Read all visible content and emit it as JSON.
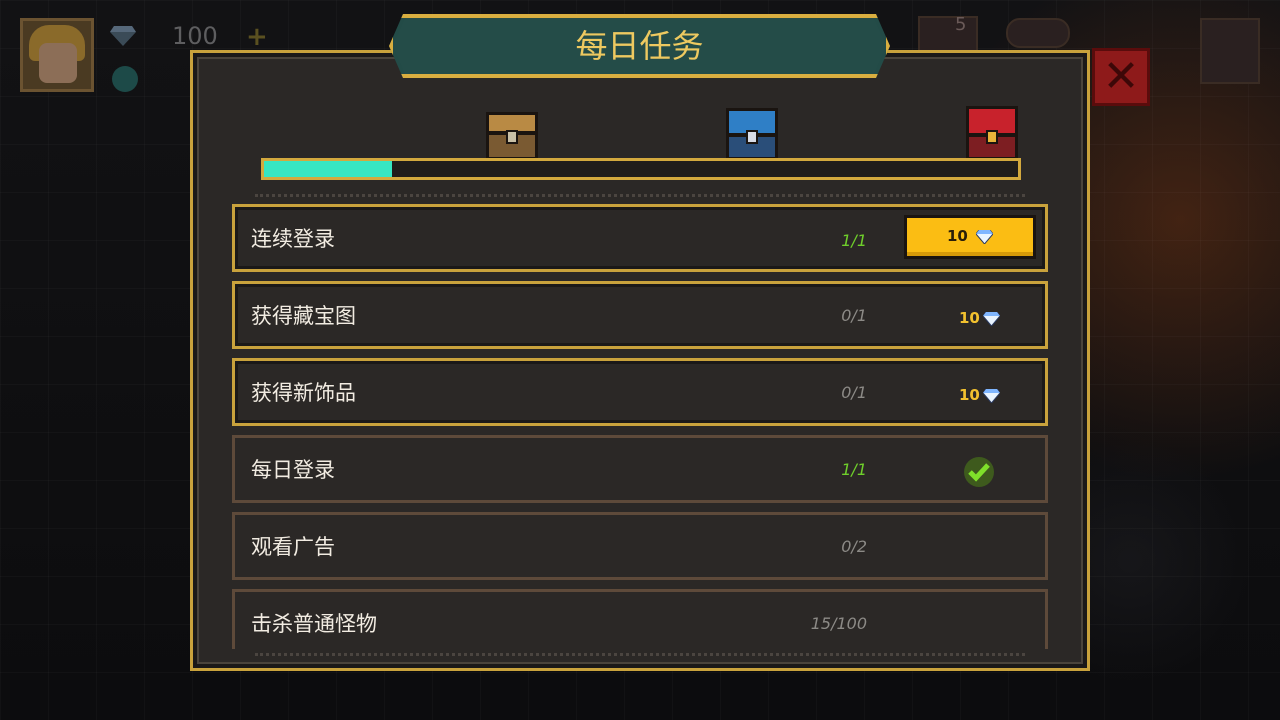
{
  "hud": {
    "gems": "100",
    "cart_badge": "5",
    "colors": {
      "gem": "#3b4b57",
      "accent": "#c9a23c"
    }
  },
  "dialog": {
    "title": "每日任务",
    "close_icon": "close-icon",
    "progress": 0.17,
    "chests": [
      {
        "icon": "wooden-chest-icon"
      },
      {
        "icon": "blue-chest-icon"
      },
      {
        "icon": "red-chest-icon"
      }
    ],
    "tasks": [
      {
        "label": "连续登录",
        "progress": "1/1",
        "reward": "10",
        "state": "claimable"
      },
      {
        "label": "获得藏宝图",
        "progress": "0/1",
        "reward": "10",
        "state": "in_progress"
      },
      {
        "label": "获得新饰品",
        "progress": "0/1",
        "reward": "10",
        "state": "in_progress"
      },
      {
        "label": "每日登录",
        "progress": "1/1",
        "reward": "",
        "state": "completed"
      },
      {
        "label": "观看广告",
        "progress": "0/2",
        "reward": "",
        "state": "in_progress"
      },
      {
        "label": "击杀普通怪物",
        "progress": "15/100",
        "reward": "",
        "state": "in_progress"
      }
    ]
  }
}
